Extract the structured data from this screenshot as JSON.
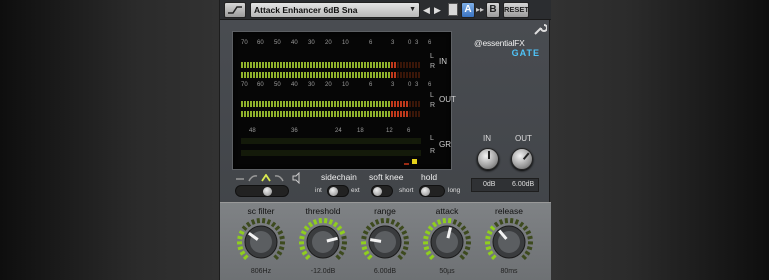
{
  "preset": {
    "name": "Attack Enhancer 6dB Sna",
    "ab_active": "A",
    "ab_inactive": "B",
    "ab_arrow": "▸▸",
    "reset_label": "RESET",
    "prev": "◀",
    "next": "▶"
  },
  "logo": {
    "brand": "essentialFX",
    "product": "GATE",
    "symbol": "@"
  },
  "meters": {
    "scale": [
      "70",
      "60",
      "50",
      "40",
      "30",
      "20",
      "10",
      "6",
      "3",
      "0",
      "3",
      "6"
    ],
    "gr_scale": [
      "48",
      "36",
      "24",
      "18",
      "12",
      "6"
    ],
    "in_label": "IN",
    "out_label": "OUT",
    "gr_label": "GR",
    "left": "L",
    "right": "R",
    "in_level": 0.87,
    "out_level": 0.93
  },
  "io": {
    "in_label": "IN",
    "out_label": "OUT",
    "in_value": "0dB",
    "out_value": "6.00dB"
  },
  "sidechain": {
    "label": "sidechain",
    "int": "int",
    "ext": "ext"
  },
  "soft_knee": {
    "label": "soft knee"
  },
  "hold": {
    "label": "hold",
    "short": "short",
    "long": "long"
  },
  "knobs": [
    {
      "label": "sc filter",
      "value": "806Hz",
      "level": 0.3
    },
    {
      "label": "threshold",
      "value": "-12.0dB",
      "level": 0.78
    },
    {
      "label": "range",
      "value": "6.00dB",
      "level": 0.2
    },
    {
      "label": "attack",
      "value": "50µs",
      "level": 0.55
    },
    {
      "label": "release",
      "value": "80ms",
      "level": 0.35
    }
  ],
  "colors": {
    "accent": "#4fc3f7",
    "meter_green": "#8fb22c",
    "meter_red": "#c0391b",
    "gr_yellow": "#e6d21a"
  }
}
